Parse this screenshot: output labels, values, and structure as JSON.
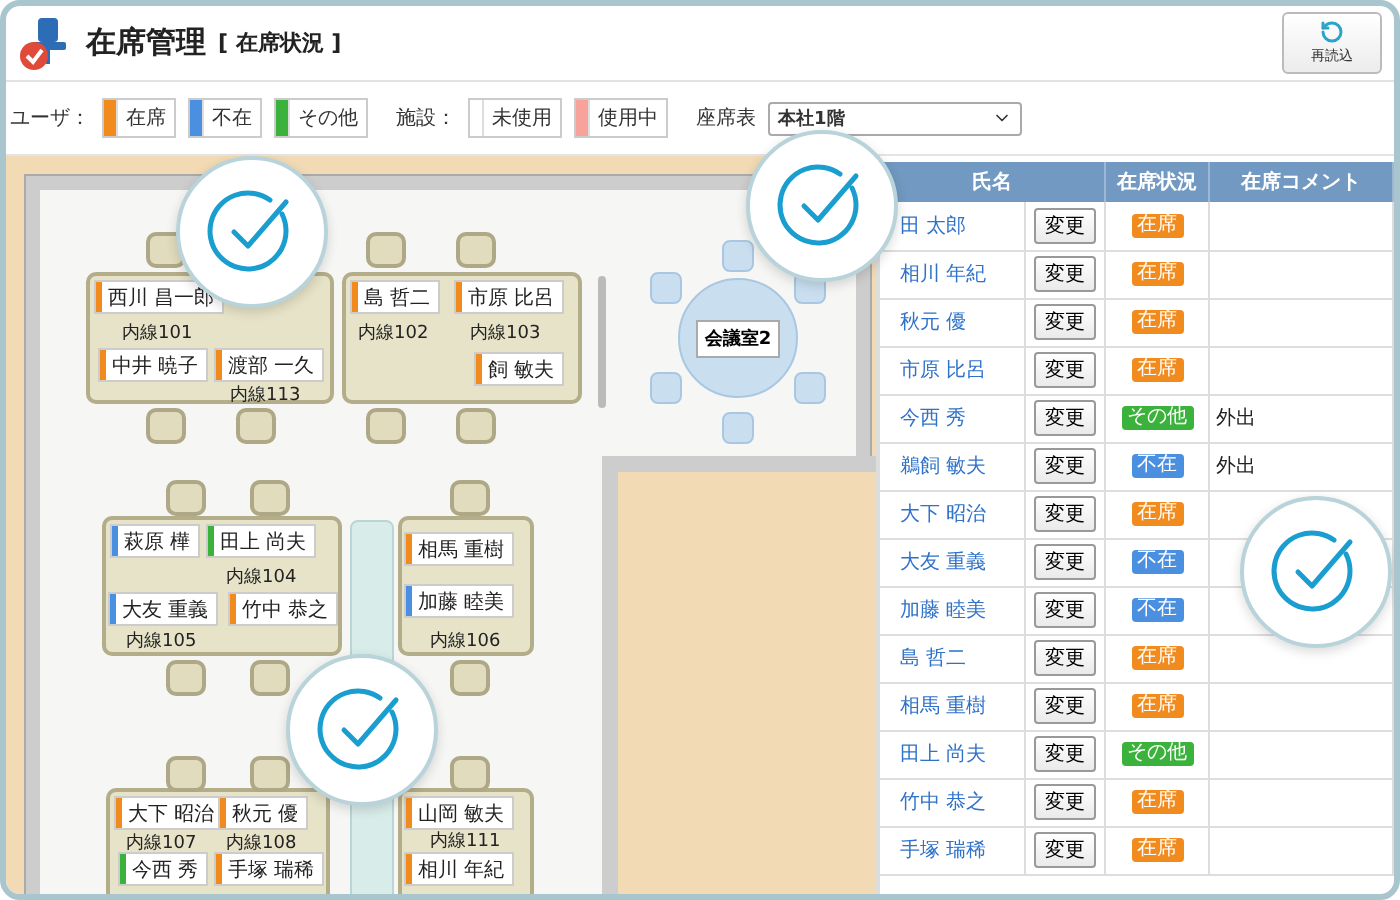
{
  "header": {
    "title": "在席管理",
    "subtitle": "[ 在席状況 ]",
    "reload_button": "再読込"
  },
  "legend": {
    "user_label": "ユーザ：",
    "user_statuses": [
      {
        "label": "在席",
        "color": "#f28b1e"
      },
      {
        "label": "不在",
        "color": "#4a8fe0"
      },
      {
        "label": "その他",
        "color": "#3bb23b"
      }
    ],
    "facility_label": "施設：",
    "facility_statuses": [
      {
        "label": "未使用",
        "color": "#ffffff"
      },
      {
        "label": "使用中",
        "color": "#f7a39b"
      }
    ],
    "seat_map_label": "座席表",
    "seat_map_value": "本社1階"
  },
  "floor_plan": {
    "nameplates": [
      {
        "name": "西川 昌一郎",
        "color": "#f28b1e"
      },
      {
        "name": "中井 暁子",
        "color": "#f28b1e"
      },
      {
        "name": "渡部 一久",
        "color": "#f28b1e"
      },
      {
        "name": "島 哲二",
        "color": "#f28b1e"
      },
      {
        "name": "市原 比呂",
        "color": "#f28b1e"
      },
      {
        "name": "飼 敏夫",
        "color": "#f28b1e"
      },
      {
        "name": "萩原 樺",
        "color": "#4a8fe0"
      },
      {
        "name": "田上 尚夫",
        "color": "#3bb23b"
      },
      {
        "name": "大友 重義",
        "color": "#4a8fe0"
      },
      {
        "name": "竹中 恭之",
        "color": "#f28b1e"
      },
      {
        "name": "相馬 重樹",
        "color": "#f28b1e"
      },
      {
        "name": "加藤 睦美",
        "color": "#4a8fe0"
      },
      {
        "name": "大下 昭治",
        "color": "#f28b1e"
      },
      {
        "name": "秋元 優",
        "color": "#f28b1e"
      },
      {
        "name": "今西 秀",
        "color": "#3bb23b"
      },
      {
        "name": "手塚 瑞稀",
        "color": "#f28b1e"
      },
      {
        "name": "山岡 敏夫",
        "color": "#f28b1e"
      },
      {
        "name": "相川 年紀",
        "color": "#f28b1e"
      }
    ],
    "extensions": [
      "内線101",
      "内線113",
      "内線102",
      "内線103",
      "内線104",
      "内線105",
      "内線106",
      "内線107",
      "内線108",
      "内線111"
    ],
    "meeting_room": {
      "label": "会議室2",
      "color": "#ffffff"
    }
  },
  "table": {
    "columns": [
      "氏名",
      "在席状況",
      "在席コメント"
    ],
    "rows": [
      {
        "name": "田 太郎",
        "button": "変更",
        "status": "在席",
        "color": "#f28b1e"
      },
      {
        "name": "相川 年紀",
        "button": "変更",
        "status": "在席",
        "color": "#f28b1e"
      },
      {
        "name": "秋元 優",
        "button": "変更",
        "status": "在席",
        "color": "#f28b1e"
      },
      {
        "name": "市原 比呂",
        "button": "変更",
        "status": "在席",
        "color": "#f28b1e"
      },
      {
        "name": "今西 秀",
        "button": "変更",
        "status": "その他",
        "color": "#3bb23b",
        "comment": "外出"
      },
      {
        "name": "鵜飼 敏夫",
        "button": "変更",
        "status": "不在",
        "color": "#4a8fe0",
        "comment": "外出"
      },
      {
        "name": "大下 昭治",
        "button": "変更",
        "status": "在席",
        "color": "#f28b1e"
      },
      {
        "name": "大友 重義",
        "button": "変更",
        "status": "不在",
        "color": "#4a8fe0"
      },
      {
        "name": "加藤 睦美",
        "button": "変更",
        "status": "不在",
        "color": "#4a8fe0"
      },
      {
        "name": "島 哲二",
        "button": "変更",
        "status": "在席",
        "color": "#f28b1e"
      },
      {
        "name": "相馬 重樹",
        "button": "変更",
        "status": "在席",
        "color": "#f28b1e"
      },
      {
        "name": "田上 尚夫",
        "button": "変更",
        "status": "その他",
        "color": "#3bb23b"
      },
      {
        "name": "竹中 恭之",
        "button": "変更",
        "status": "在席",
        "color": "#f28b1e"
      },
      {
        "name": "手塚 瑞稀",
        "button": "変更",
        "status": "在席",
        "color": "#f28b1e"
      }
    ]
  }
}
